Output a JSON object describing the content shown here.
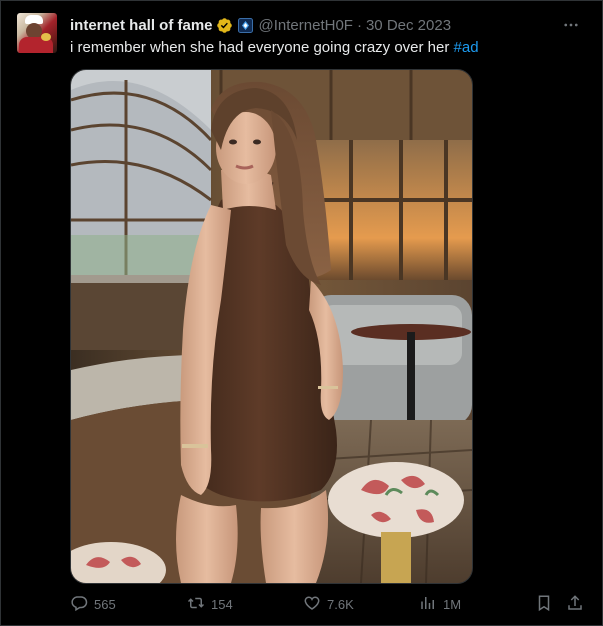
{
  "tweet": {
    "display_name": "internet hall of fame",
    "handle": "@InternetH0F",
    "separator": "·",
    "date": "30 Dec 2023",
    "text": "i remember when she had everyone going crazy over her ",
    "hashtag": "#ad",
    "more_label": "···"
  },
  "actions": {
    "replies": "565",
    "reposts": "154",
    "likes": "7.6K",
    "views": "1M"
  },
  "colors": {
    "background": "#000000",
    "text": "#e7e9ea",
    "muted": "#71767b",
    "link": "#1d9bf0",
    "verified": "#e2b719",
    "border": "#2f3336"
  },
  "icons": {
    "verified": "gold-verified-badge-icon",
    "affiliate": "affiliate-badge-icon",
    "more": "more-dots-icon",
    "reply": "reply-bubble-icon",
    "repost": "repost-arrows-icon",
    "like": "heart-icon",
    "views": "analytics-bars-icon",
    "bookmark": "bookmark-icon",
    "share": "share-icon"
  }
}
